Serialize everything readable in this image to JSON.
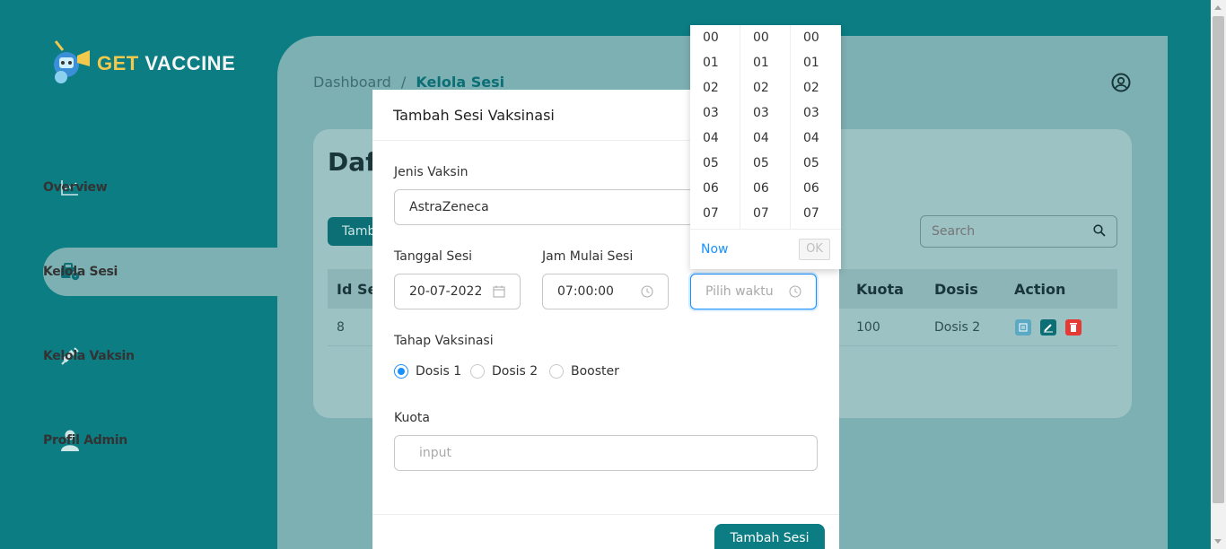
{
  "logo": {
    "part1": "GET",
    "part2": "VACCINE"
  },
  "sidebar": {
    "items": [
      {
        "label": "Overview",
        "icon": "chart-line-icon"
      },
      {
        "label": "Kelola Sesi",
        "icon": "car-clock-icon"
      },
      {
        "label": "Kelola Vaksin",
        "icon": "syringe-icon"
      },
      {
        "label": "Profil Admin",
        "icon": "user-icon"
      }
    ]
  },
  "breadcrumb": {
    "parent": "Dashboard",
    "separator": "/",
    "current": "Kelola Sesi"
  },
  "card": {
    "title": "Daft",
    "add_button": "Tamb",
    "search_placeholder": "Search",
    "columns": [
      "Id Ses",
      "Kuota",
      "Dosis",
      "Action"
    ],
    "row": {
      "id": "8",
      "kuota": "100",
      "dosis": "Dosis 2"
    }
  },
  "modal": {
    "title": "Tambah Sesi Vaksinasi",
    "jenis_label": "Jenis Vaksin",
    "jenis_value": "AstraZeneca",
    "tanggal_label": "Tanggal Sesi",
    "tanggal_value": "20-07-2022",
    "jam_mulai_label": "Jam Mulai Sesi",
    "jam_mulai_value": "07:00:00",
    "jam_selesai_placeholder": "Pilih waktu",
    "tahap_label": "Tahap Vaksinasi",
    "tahap_options": [
      "Dosis 1",
      "Dosis 2",
      "Booster"
    ],
    "tahap_selected": "Dosis 1",
    "kuota_label": "Kuota",
    "kuota_placeholder": "input",
    "submit": "Tambah Sesi"
  },
  "timepicker": {
    "hours": [
      "00",
      "01",
      "02",
      "03",
      "04",
      "05",
      "06",
      "07"
    ],
    "minutes": [
      "00",
      "01",
      "02",
      "03",
      "04",
      "05",
      "06",
      "07"
    ],
    "seconds": [
      "00",
      "01",
      "02",
      "03",
      "04",
      "05",
      "06",
      "07"
    ],
    "now_label": "Now",
    "ok_label": "OK"
  },
  "colors": {
    "primary": "#0b7d83",
    "accent": "#1890ff",
    "delete": "#e53935"
  }
}
